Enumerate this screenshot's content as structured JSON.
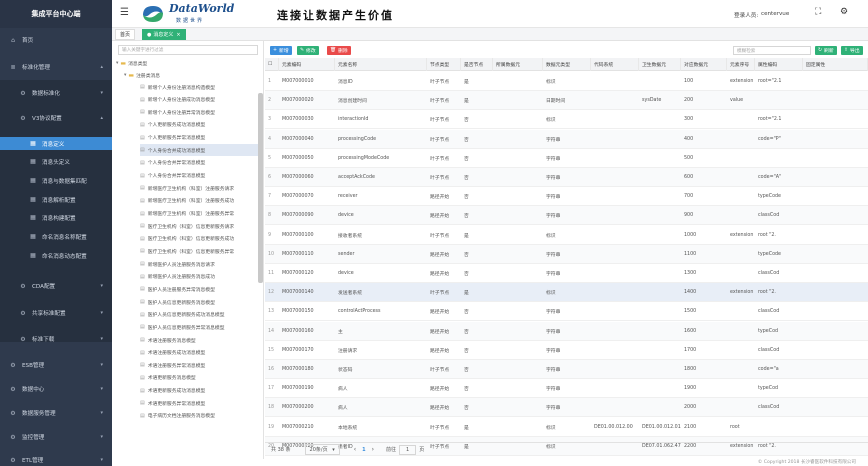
{
  "sidebar": {
    "title": "集成平台中心端",
    "items": [
      {
        "label": "首页",
        "icon": "home-icon"
      },
      {
        "label": "标准化管理",
        "icon": "stack-icon"
      },
      {
        "label": "数据标准化",
        "icon": "gear-icon"
      },
      {
        "label": "V3协议配置",
        "icon": "gear-icon"
      },
      {
        "label": "消息定义"
      },
      {
        "label": "消息头定义"
      },
      {
        "label": "消息与数据集匹配"
      },
      {
        "label": "消息解析配置"
      },
      {
        "label": "消息构建配置"
      },
      {
        "label": "命名消息名称配置"
      },
      {
        "label": "命名消息动态配置"
      },
      {
        "label": "CDA配置",
        "icon": "gear-icon"
      },
      {
        "label": "共享标准配置",
        "icon": "gear-icon"
      },
      {
        "label": "标准下载",
        "icon": "gear-icon"
      },
      {
        "label": "ESB管理",
        "icon": "gear-icon"
      },
      {
        "label": "数据中心",
        "icon": "gear-icon"
      },
      {
        "label": "数据服务管理",
        "icon": "gear-icon"
      },
      {
        "label": "监控管理",
        "icon": "gear-icon"
      },
      {
        "label": "ETL管理",
        "icon": "gear-icon"
      }
    ]
  },
  "header": {
    "logo_text": "DataWorld",
    "logo_sub": "数据世界",
    "slogan": "连接让数据产生价值",
    "login_label": "登录人员:",
    "user": "centervue"
  },
  "tabs": [
    {
      "label": "首页"
    },
    {
      "label": "消息定义"
    }
  ],
  "tree": {
    "search_placeholder": "输入关键字进行过滤",
    "root": "消息类型",
    "group": "注册类消息",
    "items": [
      "新增个人身份注册消息构造模型",
      "新增个人身份注册成功消息模型",
      "新增个人身份注册异常消息模型",
      "个人更新服务成功消息模型",
      "个人更新服务异常消息模型",
      "个人身份合并成功消息模型",
      "个人身份合并异常消息模型",
      "个人身份合并异常消息模型",
      "新增医疗卫生机构（科室）注册服务请求",
      "新增医疗卫生机构（科室）注册服务成功",
      "新增医疗卫生机构（科室）注册服务异常",
      "医疗卫生机构（科室）信息更新服务请求",
      "医疗卫生机构（科室）信息更新服务成功",
      "医疗卫生机构（科室）信息更新服务异常",
      "新增医护人员注册服务消息请求",
      "新增医护人员注册服务消息成功",
      "医护人员注册服务异常消息模型",
      "医护人员信息更新服务消息模型",
      "医护人员信息更新服务成功消息模型",
      "医护人员信息更新服务异常消息模型",
      "术语注册服务消息模型",
      "术语注册服务成功消息模型",
      "术语注册服务异常消息模型",
      "术语更新服务消息模型",
      "术语更新服务成功消息模型",
      "术语更新服务异常消息模型",
      "电子病历文档注册服务消息模型"
    ]
  },
  "toolbar": {
    "add": "新增",
    "edit": "修改",
    "delete": "删除",
    "search_placeholder": "模糊检索",
    "refresh": "刷新",
    "export": "导出"
  },
  "table": {
    "columns": [
      "元素编码",
      "元素名称",
      "节点类型",
      "是否节点",
      "所属数据元",
      "数据元类型",
      "代码系统",
      "卫生数据元",
      "对应数据元",
      "元素序号",
      "属性编码",
      "固定属性"
    ],
    "rows": [
      [
        "1",
        "M007000010",
        "消息ID",
        "叶子节点",
        "是",
        "",
        "标识",
        "",
        "",
        "100",
        "extension",
        "root=\"2.1"
      ],
      [
        "2",
        "M007000020",
        "消息创建时间",
        "叶子节点",
        "是",
        "",
        "日期时间",
        "",
        "sysDate",
        "200",
        "value",
        ""
      ],
      [
        "3",
        "M007000030",
        "interactionId",
        "叶子节点",
        "否",
        "",
        "标识",
        "",
        "",
        "300",
        "",
        "root=\"2.1"
      ],
      [
        "4",
        "M007000040",
        "processingCode",
        "叶子节点",
        "否",
        "",
        "字符串",
        "",
        "",
        "400",
        "",
        "code=\"P\""
      ],
      [
        "5",
        "M007000050",
        "processingModeCode",
        "叶子节点",
        "否",
        "",
        "字符串",
        "",
        "",
        "500",
        "",
        ""
      ],
      [
        "6",
        "M007000060",
        "acceptAckCode",
        "叶子节点",
        "否",
        "",
        "字符串",
        "",
        "",
        "600",
        "",
        "code=\"A\""
      ],
      [
        "7",
        "M007000070",
        "receiver",
        "路径开始",
        "否",
        "",
        "字符串",
        "",
        "",
        "700",
        "",
        "typeCode"
      ],
      [
        "8",
        "M007000090",
        "device",
        "路径开始",
        "否",
        "",
        "字符串",
        "",
        "",
        "900",
        "",
        "classCod"
      ],
      [
        "9",
        "M007000100",
        "接收者系统",
        "叶子节点",
        "是",
        "",
        "标识",
        "",
        "",
        "1000",
        "extension",
        "root \"2."
      ],
      [
        "10",
        "M007000110",
        "sender",
        "路径开始",
        "否",
        "",
        "字符串",
        "",
        "",
        "1100",
        "",
        "typeCode"
      ],
      [
        "11",
        "M007000120",
        "device",
        "路径开始",
        "否",
        "",
        "字符串",
        "",
        "",
        "1300",
        "",
        "classCod"
      ],
      [
        "12",
        "M007000140",
        "发送者系统",
        "叶子节点",
        "是",
        "",
        "标识",
        "",
        "",
        "1400",
        "extension",
        "root \"2."
      ],
      [
        "13",
        "M007000150",
        "controlActProcess",
        "路径开始",
        "否",
        "",
        "字符串",
        "",
        "",
        "1500",
        "",
        "classCod"
      ],
      [
        "14",
        "M007000160",
        "主",
        "路径开始",
        "否",
        "",
        "字符串",
        "",
        "",
        "1600",
        "",
        "typeCod"
      ],
      [
        "15",
        "M007000170",
        "注册请求",
        "路径开始",
        "否",
        "",
        "字符串",
        "",
        "",
        "1700",
        "",
        "classCod"
      ],
      [
        "16",
        "M007000180",
        "状态码",
        "叶子节点",
        "否",
        "",
        "字符串",
        "",
        "",
        "1800",
        "",
        "code=\"a"
      ],
      [
        "17",
        "M007000190",
        "病人",
        "路径开始",
        "否",
        "",
        "字符串",
        "",
        "",
        "1900",
        "",
        "typeCod"
      ],
      [
        "18",
        "M007000200",
        "病人",
        "路径开始",
        "否",
        "",
        "字符串",
        "",
        "",
        "2000",
        "",
        "classCod"
      ],
      [
        "19",
        "M007000210",
        "本地系统",
        "叶子节点",
        "是",
        "",
        "标识",
        "DE01.00.012.00",
        "DE01.00.012.01",
        "2100",
        "root",
        ""
      ],
      [
        "20",
        "M007000220",
        "患者ID",
        "叶子节点",
        "是",
        "",
        "标识",
        "",
        "DE07.01.062.47",
        "2200",
        "extension",
        "root \"2."
      ]
    ]
  },
  "pager": {
    "total": "共 38 条",
    "page_size": "20条/页",
    "goto_label": "前往",
    "page": "1",
    "page_suffix": "页"
  },
  "footer": "© Copyright 2018 长沙睿医软件科技有限公司"
}
